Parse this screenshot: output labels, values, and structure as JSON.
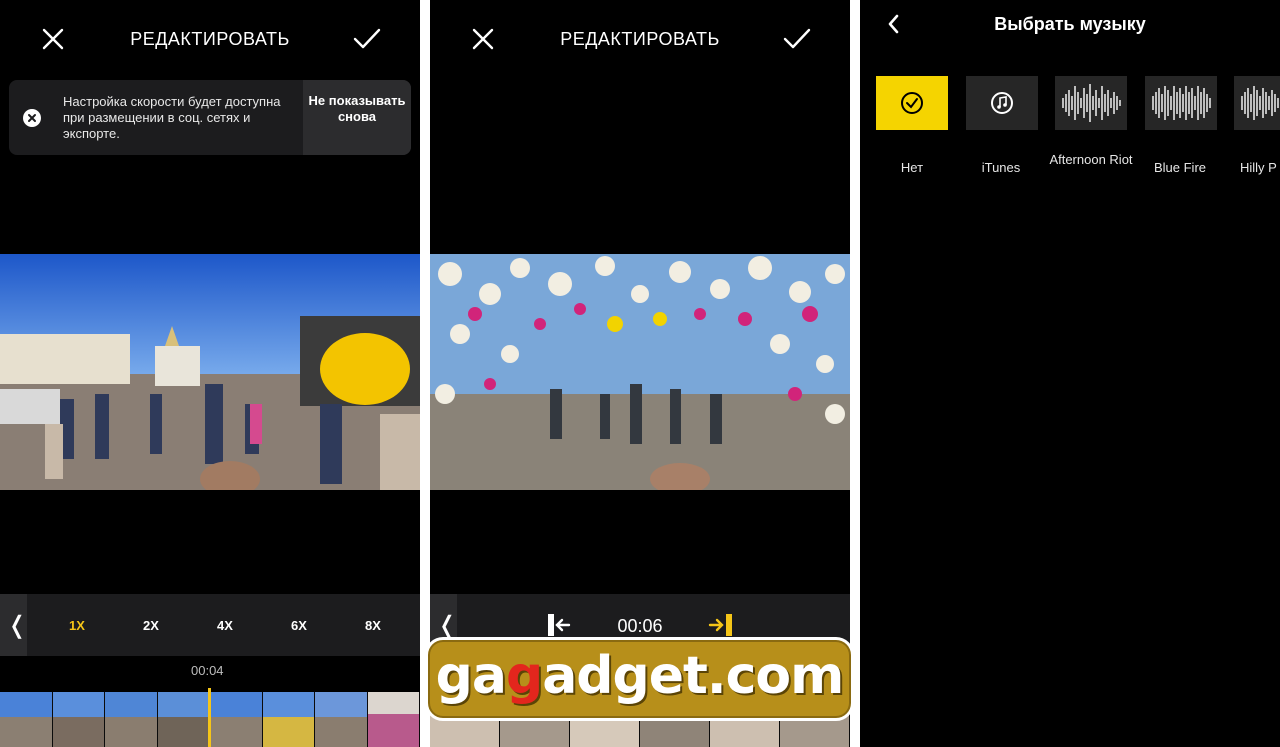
{
  "screens": [
    {
      "header": {
        "title": "РЕДАКТИРОВАТЬ",
        "close_icon": "close-icon",
        "confirm_icon": "checkmark-icon"
      },
      "toast": {
        "message": "Настройка скорости будет доступна при размещении в соц. сетях и экспорте.",
        "dismiss_label": "Не показывать снова"
      },
      "speed_selector": {
        "back_label": "❬",
        "options": [
          "1X",
          "2X",
          "4X",
          "6X",
          "8X"
        ],
        "selected": "1X"
      },
      "timecode": "00:04"
    },
    {
      "header": {
        "title": "РЕДАКТИРОВАТЬ",
        "close_icon": "close-icon",
        "confirm_icon": "checkmark-icon"
      },
      "trim_bar": {
        "back_label": "❬",
        "timecode": "00:06",
        "trim_start_icon": "trim-start-icon",
        "trim_end_icon": "trim-end-icon"
      }
    },
    {
      "header": {
        "title": "Выбрать музыку",
        "back_icon": "chevron-left-icon"
      },
      "tracks": [
        {
          "label": "Нет",
          "selected": true,
          "icon": "check-circle-icon"
        },
        {
          "label": "iTunes",
          "selected": false,
          "icon": "music-note-icon"
        },
        {
          "label": "Afternoon Riot",
          "selected": false,
          "icon": "waveform-icon"
        },
        {
          "label": "Blue Fire",
          "selected": false,
          "icon": "waveform-icon"
        },
        {
          "label": "Hilly P",
          "selected": false,
          "icon": "waveform-icon"
        }
      ]
    }
  ],
  "watermark": {
    "prefix": "ga",
    "middle": "g",
    "suffix": "adget.com"
  },
  "colors": {
    "accent": "#f5c518",
    "background": "#000000",
    "panel": "#1c1c1e"
  }
}
